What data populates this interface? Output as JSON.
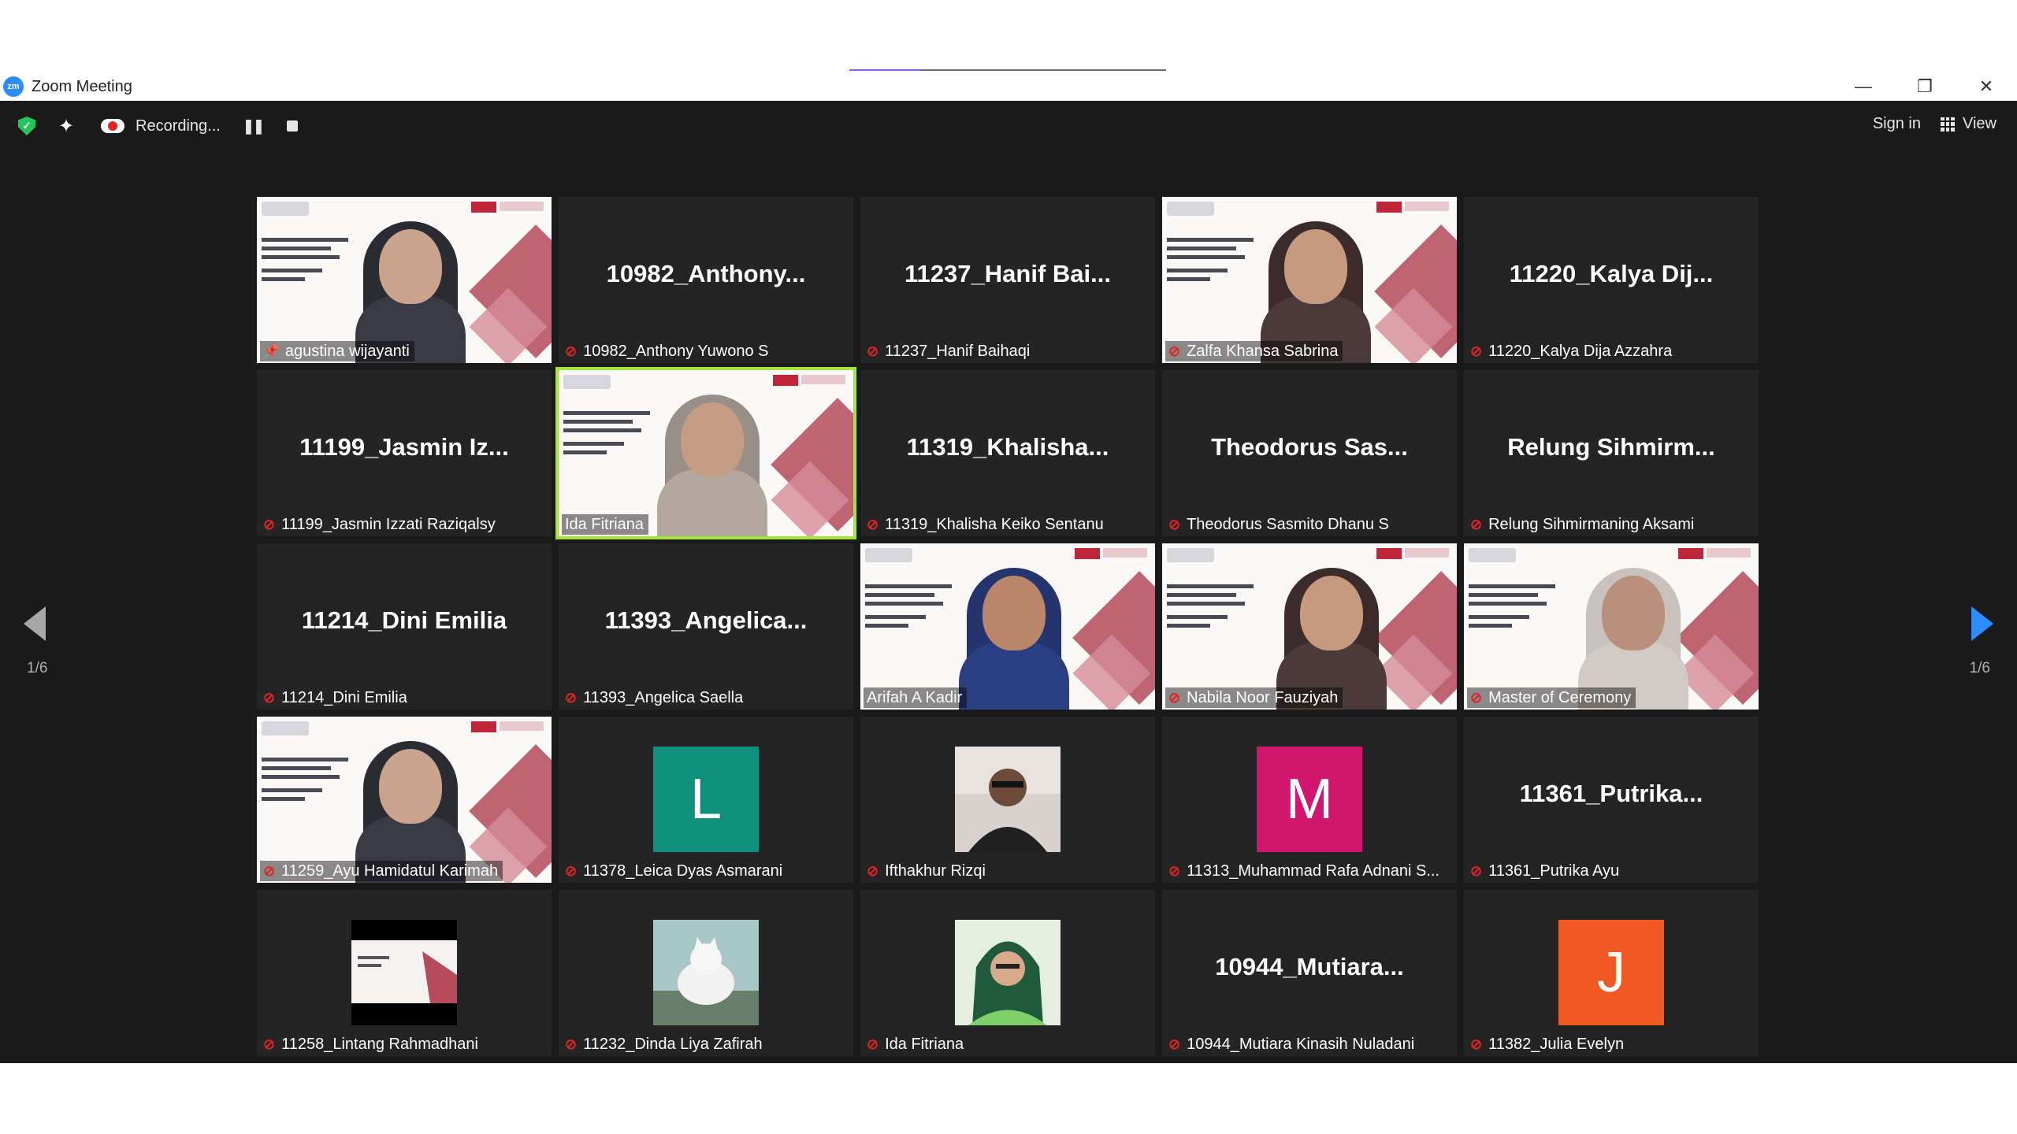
{
  "window": {
    "title": "Zoom Meeting",
    "minimize": "—",
    "restore": "❐",
    "close": "✕"
  },
  "toolbar": {
    "recording_label": "Recording...",
    "pause_icon": "❚❚",
    "sign_in": "Sign in",
    "view": "View"
  },
  "pagination": {
    "left": "1/6",
    "right": "1/6"
  },
  "tiles": [
    {
      "name": "agustina wijayanti",
      "label": "agustina wijayanti",
      "video": "slide",
      "icon": "pin"
    },
    {
      "name": "10982_Anthony...",
      "label": "10982_Anthony Yuwono S",
      "video": "off",
      "icon": "mic-off"
    },
    {
      "name": "11237_Hanif  Bai...",
      "label": "11237_Hanif Baihaqi",
      "video": "off",
      "icon": "mic-off"
    },
    {
      "name": "Zalfa Khansa Sabrina",
      "label": "Zalfa Khansa Sabrina",
      "video": "slide",
      "icon": "mic-off"
    },
    {
      "name": "11220_Kalya  Dij...",
      "label": "11220_Kalya Dija Azzahra",
      "video": "off",
      "icon": "mic-off"
    },
    {
      "name": "11199_Jasmin  Iz...",
      "label": "11199_Jasmin Izzati Raziqalsy",
      "video": "off",
      "icon": "mic-off"
    },
    {
      "name": "Ida Fitriana",
      "label": "Ida Fitriana",
      "video": "slide",
      "icon": "none",
      "active": true
    },
    {
      "name": "11319_Khalisha...",
      "label": "11319_Khalisha Keiko Sentanu",
      "video": "off",
      "icon": "mic-off"
    },
    {
      "name": "Theodorus  Sas...",
      "label": "Theodorus Sasmito Dhanu S",
      "video": "off",
      "icon": "mic-off"
    },
    {
      "name": "Relung  Sihmirm...",
      "label": "Relung Sihmirmaning Aksami",
      "video": "off",
      "icon": "mic-off"
    },
    {
      "name": "11214_Dini Emilia",
      "label": "11214_Dini Emilia",
      "video": "off",
      "icon": "mic-off"
    },
    {
      "name": "11393_Angelica...",
      "label": "11393_Angelica Saella",
      "video": "off",
      "icon": "mic-off"
    },
    {
      "name": "Arifah A Kadir",
      "label": "Arifah A Kadir",
      "video": "slide",
      "icon": "none"
    },
    {
      "name": "Nabila Noor Fauziyah",
      "label": "Nabila Noor Fauziyah",
      "video": "slide",
      "icon": "mic-off"
    },
    {
      "name": "Master of Ceremony",
      "label": "Master of Ceremony",
      "video": "slide",
      "icon": "mic-off"
    },
    {
      "name": "11259_Ayu Hamidatul Karimah",
      "label": "11259_Ayu Hamidatul Karimah",
      "video": "slide",
      "icon": "mic-off"
    },
    {
      "name": "11378_Leica Dyas Asmarani",
      "label": "11378_Leica Dyas Asmarani",
      "video": "avatar",
      "letter": "L",
      "color": "#0f8f7e",
      "icon": "mic-off"
    },
    {
      "name": "Ifthakhur Rizqi",
      "label": "Ifthakhur Rizqi",
      "video": "photo-man",
      "icon": "mic-off"
    },
    {
      "name": "11313_Muhammad Rafa Adnani S...",
      "label": "11313_Muhammad Rafa Adnani S...",
      "video": "avatar",
      "letter": "M",
      "color": "#d0166f",
      "icon": "mic-off"
    },
    {
      "name": "11361_Putrika...",
      "label": "11361_Putrika Ayu",
      "video": "off",
      "icon": "mic-off"
    },
    {
      "name": "11258_Lintang Rahmadhani",
      "label": "11258_Lintang Rahmadhani",
      "video": "photo-slide",
      "icon": "mic-off"
    },
    {
      "name": "11232_Dinda Liya Zafirah",
      "label": "11232_Dinda Liya Zafirah",
      "video": "photo-cat",
      "icon": "mic-off"
    },
    {
      "name": "Ida Fitriana",
      "label": "Ida Fitriana",
      "video": "photo-woman",
      "icon": "mic-off"
    },
    {
      "name": "10944_Mutiara...",
      "label": "10944_Mutiara Kinasih Nuladani",
      "video": "off",
      "icon": "mic-off"
    },
    {
      "name": "11382_Julia Evelyn",
      "label": "11382_Julia Evelyn",
      "video": "avatar",
      "letter": "J",
      "color": "#f05a22",
      "icon": "mic-off"
    }
  ],
  "colors": {
    "active_speaker": "#a3e635",
    "mic_muted": "#e02424",
    "accent": "#2d8cff",
    "background": "#1a1a1a"
  }
}
